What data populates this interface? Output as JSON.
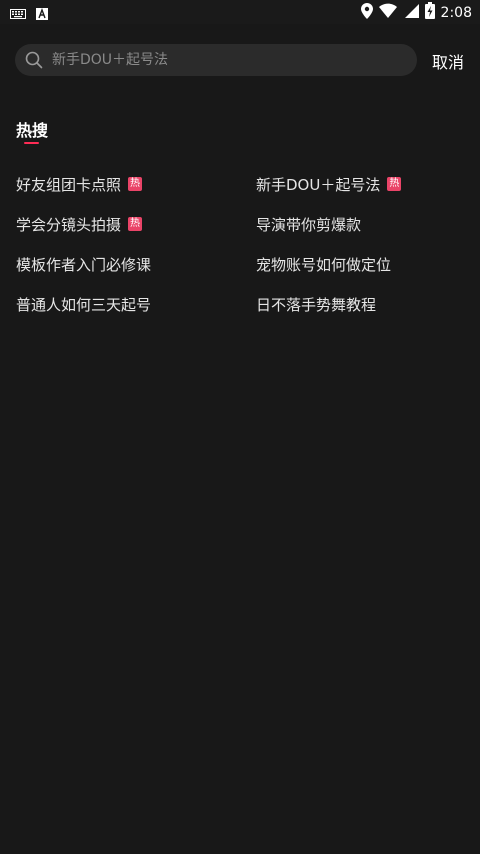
{
  "status_bar": {
    "time": "2:08",
    "icons": [
      "keyboard-icon",
      "android-notification-icon",
      "location-icon",
      "wifi-icon",
      "signal-icon",
      "battery-charging-icon"
    ]
  },
  "search": {
    "placeholder": "新手DOU＋起号法",
    "value": "",
    "cancel_label": "取消"
  },
  "hot_section": {
    "title": "热搜",
    "badge_label": "热",
    "accent_color": "#fe2c55",
    "items": [
      {
        "text": "好友组团卡点照",
        "hot": true
      },
      {
        "text": "新手DOU＋起号法",
        "hot": true
      },
      {
        "text": "学会分镜头拍摄",
        "hot": true
      },
      {
        "text": "导演带你剪爆款",
        "hot": false
      },
      {
        "text": "模板作者入门必修课",
        "hot": false
      },
      {
        "text": "宠物账号如何做定位",
        "hot": false
      },
      {
        "text": "普通人如何三天起号",
        "hot": false
      },
      {
        "text": "日不落手势舞教程",
        "hot": false
      }
    ]
  }
}
